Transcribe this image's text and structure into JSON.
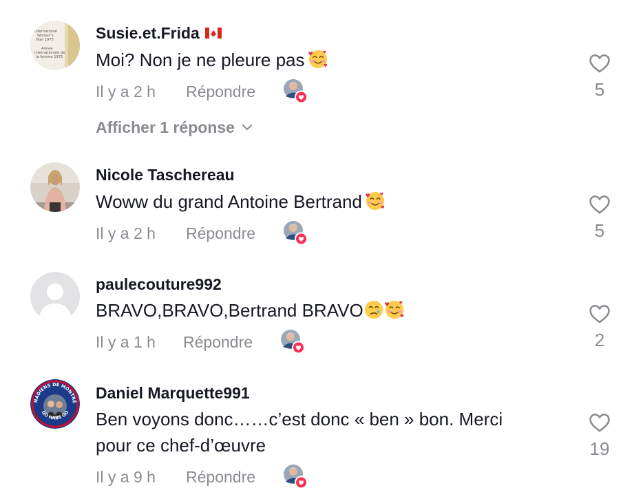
{
  "comments": [
    {
      "username": "Susie.et.Frida",
      "text": "Moi? Non je ne pleure pas",
      "time": "Il y a 2 h",
      "reply_label": "Répondre",
      "likes": "5",
      "view_replies": "Afficher 1 réponse",
      "avatar_text": [
        "International",
        "Women's",
        "Year 1975",
        "Année",
        "internationale de",
        "la femme 1975"
      ]
    },
    {
      "username": "Nicole Taschereau",
      "text": "Woww du grand Antoine Bertrand",
      "time": "Il y a 2 h",
      "reply_label": "Répondre",
      "likes": "5"
    },
    {
      "username": "paulecouture992",
      "text": "BRAVO,BRAVO,Bertrand BRAVO",
      "time": "Il y a 1 h",
      "reply_label": "Répondre",
      "likes": "2"
    },
    {
      "username": "Daniel Marquette991",
      "text_line1": "Ben voyons donc……c’est donc « ben » bon. Merci",
      "text_line2": "pour ce chef-d’œuvre",
      "time": "Il y a 9 h",
      "reply_label": "Répondre",
      "likes": "19",
      "avatar_text_top": "CANADIENS DE MONTRÉAL",
      "avatar_text_bottom": "GO HABS GO"
    }
  ],
  "icons": {
    "like": "heart-outline-icon",
    "creator_like": "creator-liked-badge-icon",
    "flag": "canada-flag-icon",
    "expand": "chevron-down-icon",
    "emoji_love": "smiling-face-with-hearts-emoji",
    "emoji_cry": "crying-face-emoji"
  },
  "colors": {
    "text": "#161823",
    "secondary": "#8a8b91",
    "like_badge": "#fe2c55",
    "flag_red": "#d52b1e"
  }
}
